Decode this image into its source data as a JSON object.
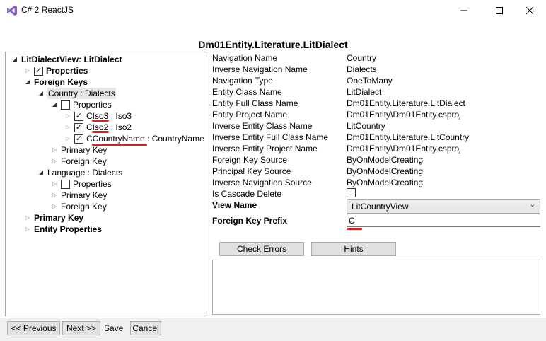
{
  "window": {
    "title": "C# 2 ReactJS",
    "icon": "visual-studio-icon",
    "minimize_icon": "minimize-icon",
    "maximize_icon": "maximize-icon",
    "close_icon": "close-icon"
  },
  "page_title": "Dm01Entity.Literature.LitDialect",
  "tree": {
    "root": "LitDialectView: LitDialect",
    "properties": "Properties",
    "foreign_keys": "Foreign Keys",
    "country": "Country : Dialects",
    "country_properties": "Properties",
    "ciso3": "CIso3",
    "ciso3_type": " : Iso3",
    "ciso2": "CIso2",
    "ciso2_type": " : Iso2",
    "ccountryname": "CCountryName",
    "ccountryname_type": " : CountryName",
    "country_primary_key": "Primary Key",
    "country_foreign_key": "Foreign Key",
    "language": "Language : Dialects",
    "language_properties": "Properties",
    "language_primary_key": "Primary Key",
    "language_foreign_key": "Foreign Key",
    "primary_key": "Primary Key",
    "entity_properties": "Entity Properties"
  },
  "properties": [
    {
      "label": "Navigation Name",
      "value": "Country"
    },
    {
      "label": "Inverse Navigation Name",
      "value": "Dialects"
    },
    {
      "label": "Navigation Type",
      "value": "OneToMany"
    },
    {
      "label": "Entity Class Name",
      "value": "LitDialect"
    },
    {
      "label": "Entity Full Class Name",
      "value": "Dm01Entity.Literature.LitDialect"
    },
    {
      "label": "Entity Project Name",
      "value": "Dm01Entity\\Dm01Entity.csproj"
    },
    {
      "label": "Inverse Entity Class Name",
      "value": "LitCountry"
    },
    {
      "label": "Inverse Entity Full Class Name",
      "value": "Dm01Entity.Literature.LitCountry"
    },
    {
      "label": "Inverse Entity Project Name",
      "value": "Dm01Entity\\Dm01Entity.csproj"
    },
    {
      "label": "Foreign Key Source",
      "value": "ByOnModelCreating"
    },
    {
      "label": "Principal Key Source",
      "value": "ByOnModelCreating"
    },
    {
      "label": "Inverse Navigation Source",
      "value": "ByOnModelCreating"
    }
  ],
  "cascade_label": "Is Cascade Delete",
  "view_name_label": "View Name",
  "view_name_value": "LitCountryView",
  "prefix_label": "Foreign Key Prefix",
  "prefix_value": "C",
  "buttons": {
    "check_errors": "Check Errors",
    "hints": "Hints",
    "previous": "<< Previous",
    "next": "Next >>",
    "save": "Save",
    "cancel": "Cancel"
  },
  "colors": {
    "annotation_red": "#d91f1f",
    "vs_purple": "#865fc5"
  }
}
